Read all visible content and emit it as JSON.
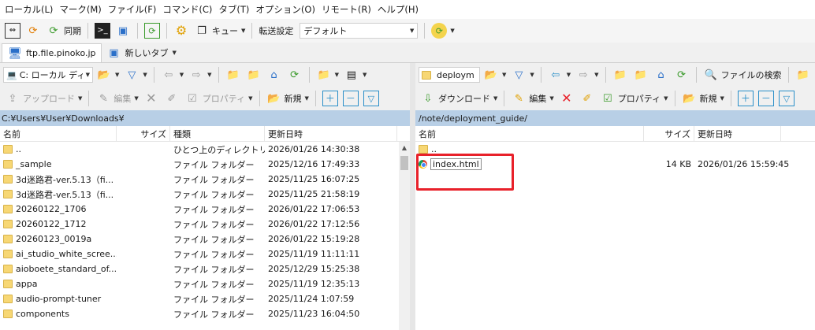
{
  "menu": [
    "ローカル(L)",
    "マーク(M)",
    "ファイル(F)",
    "コマンド(C)",
    "タブ(T)",
    "オプション(O)",
    "リモート(R)",
    "ヘルプ(H)"
  ],
  "toolbar": {
    "sync_label": "同期",
    "queue_label": "キュー",
    "transfer_label": "転送設定",
    "transfer_value": "デフォルト"
  },
  "tabs": [
    {
      "label": "ftp.file.pinoko.jp"
    },
    {
      "label": "新しいタブ"
    }
  ],
  "left": {
    "drive": "C: ローカル ディス",
    "upload": "アップロード",
    "edit": "編集",
    "properties": "プロパティ",
    "new": "新規",
    "path": "C:¥Users¥User¥Downloads¥",
    "columns": {
      "name": "名前",
      "size": "サイズ",
      "type": "種類",
      "modified": "更新日時"
    },
    "rows": [
      {
        "name": "..",
        "size": "",
        "type": "ひとつ上のディレクトリ",
        "modified": "2026/01/26 14:30:38"
      },
      {
        "name": "_sample",
        "size": "",
        "type": "ファイル フォルダー",
        "modified": "2025/12/16 17:49:33"
      },
      {
        "name": "3d迷路君-ver.5.13（fi...",
        "size": "",
        "type": "ファイル フォルダー",
        "modified": "2025/11/25 16:07:25"
      },
      {
        "name": "3d迷路君-ver.5.13（fi...",
        "size": "",
        "type": "ファイル フォルダー",
        "modified": "2025/11/25 21:58:19"
      },
      {
        "name": "20260122_1706",
        "size": "",
        "type": "ファイル フォルダー",
        "modified": "2026/01/22 17:06:53"
      },
      {
        "name": "20260122_1712",
        "size": "",
        "type": "ファイル フォルダー",
        "modified": "2026/01/22 17:12:56"
      },
      {
        "name": "20260123_0019a",
        "size": "",
        "type": "ファイル フォルダー",
        "modified": "2026/01/22 15:19:28"
      },
      {
        "name": "ai_studio_white_scree...",
        "size": "",
        "type": "ファイル フォルダー",
        "modified": "2025/11/19 11:11:11"
      },
      {
        "name": "aioboete_standard_of...",
        "size": "",
        "type": "ファイル フォルダー",
        "modified": "2025/12/29 15:25:38"
      },
      {
        "name": "appa",
        "size": "",
        "type": "ファイル フォルダー",
        "modified": "2025/11/19 12:35:13"
      },
      {
        "name": "audio-prompt-tuner",
        "size": "",
        "type": "ファイル フォルダー",
        "modified": "2025/11/24 1:07:59"
      },
      {
        "name": "components",
        "size": "",
        "type": "ファイル フォルダー",
        "modified": "2025/11/23 16:04:50"
      }
    ]
  },
  "right": {
    "site": "deploym",
    "search": "ファイルの検索",
    "download": "ダウンロード",
    "edit": "編集",
    "properties": "プロパティ",
    "new": "新規",
    "path": "/note/deployment_guide/",
    "columns": {
      "name": "名前",
      "size": "サイズ",
      "modified": "更新日時"
    },
    "rows": [
      {
        "name": "..",
        "size": "",
        "modified": "",
        "kind": "folder"
      },
      {
        "name": "index.html",
        "size": "14 KB",
        "modified": "2026/01/26 15:59:45",
        "kind": "html"
      }
    ]
  },
  "colors": {
    "path_bar": "#b8cfe6",
    "highlight": "#e8212a",
    "folder": "#f7d774"
  }
}
